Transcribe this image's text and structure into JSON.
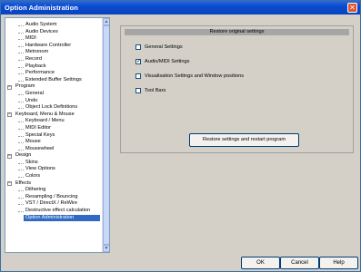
{
  "window": {
    "title": "Option Administration",
    "close_glyph": "✕"
  },
  "tree": {
    "items": [
      {
        "label": "Audio System",
        "level": 1
      },
      {
        "label": "Audio Devices",
        "level": 1
      },
      {
        "label": "MIDI",
        "level": 1
      },
      {
        "label": "Hardware Controller",
        "level": 1
      },
      {
        "label": "Metronom",
        "level": 1
      },
      {
        "label": "Record",
        "level": 1
      },
      {
        "label": "Playback",
        "level": 1
      },
      {
        "label": "Performance",
        "level": 1
      },
      {
        "label": "Extended Buffer Settings",
        "level": 1
      },
      {
        "label": "Program",
        "level": 0
      },
      {
        "label": "General",
        "level": 1
      },
      {
        "label": "Undo",
        "level": 1
      },
      {
        "label": "Object Lock Definitions",
        "level": 1
      },
      {
        "label": "Keyboard, Menu & Mouse",
        "level": 0
      },
      {
        "label": "Keyboard / Menu",
        "level": 1
      },
      {
        "label": "MIDI Editor",
        "level": 1
      },
      {
        "label": "Special Keys",
        "level": 1
      },
      {
        "label": "Mouse",
        "level": 1
      },
      {
        "label": "Mousewheel",
        "level": 1
      },
      {
        "label": "Design",
        "level": 0
      },
      {
        "label": "Skins",
        "level": 1
      },
      {
        "label": "View Options",
        "level": 1
      },
      {
        "label": "Colors",
        "level": 1
      },
      {
        "label": "Effects",
        "level": 0
      },
      {
        "label": "Dithering",
        "level": 1
      },
      {
        "label": "Resampling / Bouncing",
        "level": 1
      },
      {
        "label": "VST / DirectX / ReWire",
        "level": 1
      },
      {
        "label": "Destructive effect calculation",
        "level": 1
      },
      {
        "label": "Option Administration",
        "level": 0,
        "selected": true
      }
    ],
    "expander_glyph": "−"
  },
  "scrollbar": {
    "up_glyph": "▲",
    "down_glyph": "▼"
  },
  "restore": {
    "header": "Restore original settings",
    "options": [
      {
        "label": "General Settings",
        "checked": false
      },
      {
        "label": "Audio/MIDI Settings",
        "checked": true
      },
      {
        "label": "Visualisation Settings and Window positions",
        "checked": false
      },
      {
        "label": "Tool Bars",
        "checked": false
      }
    ],
    "check_glyph": "✓",
    "button_label": "Restore settings and restart program"
  },
  "buttons": {
    "ok": "OK",
    "cancel": "Cancel",
    "help": "Help"
  },
  "colors": {
    "title_bar": "#0a4ad0",
    "selection": "#316ac5",
    "dialog_bg": "#d4d0c8"
  }
}
